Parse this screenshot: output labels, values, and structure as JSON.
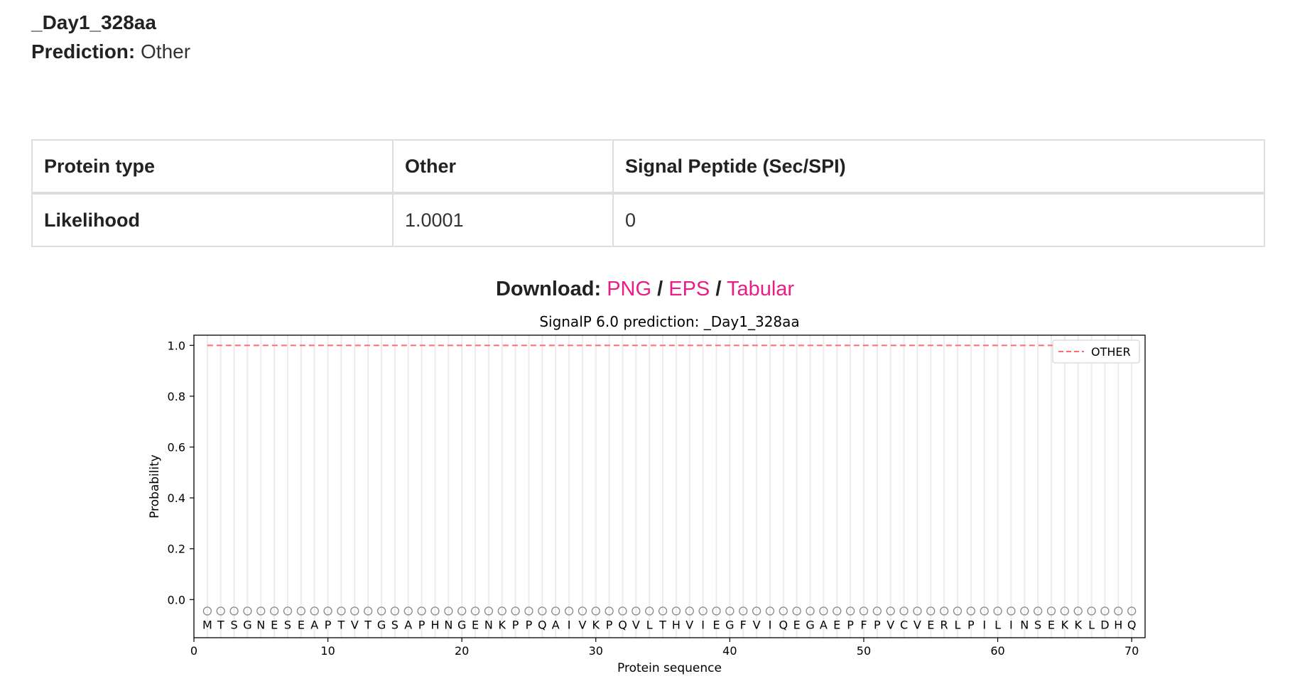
{
  "entry": {
    "name": "_Day1_328aa",
    "prediction_label": "Prediction:",
    "prediction_value": "Other"
  },
  "table": {
    "header": [
      "Protein type",
      "Other",
      "Signal Peptide (Sec/SPI)"
    ],
    "row": [
      "Likelihood",
      "1.0001",
      "0"
    ]
  },
  "download": {
    "label": "Download:",
    "links": [
      "PNG",
      "EPS",
      "Tabular"
    ],
    "separator": "/"
  },
  "colors": {
    "link": "#e91e84",
    "other_line": "#ff6b6b",
    "marker": "#888888"
  },
  "chart_data": {
    "type": "line",
    "title": "SignalP 6.0 prediction: _Day1_328aa",
    "xlabel": "Protein sequence",
    "ylabel": "Probability",
    "xlim": [
      0,
      71
    ],
    "ylim": [
      -0.15,
      1.04
    ],
    "x_ticks": [
      0,
      10,
      20,
      30,
      40,
      50,
      60,
      70
    ],
    "y_ticks": [
      0.0,
      0.2,
      0.4,
      0.6,
      0.8,
      1.0
    ],
    "y_tick_labels": [
      "0.0",
      "0.2",
      "0.4",
      "0.6",
      "0.8",
      "1.0"
    ],
    "sequence": "MTSGNESEAPTVTGSAPHNGENKPPQAIVKPQVLTHVIEGFVIQEGAEPFPVCVERLPILINSEKKLDHQ",
    "series": [
      {
        "name": "OTHER",
        "style": "dashed",
        "color": "#ff6b6b",
        "x_start": 1,
        "x_end": 65,
        "value": 1.0
      }
    ],
    "residue_marker_y": -0.045,
    "grid_vertical": true,
    "legend_position": "upper right"
  }
}
